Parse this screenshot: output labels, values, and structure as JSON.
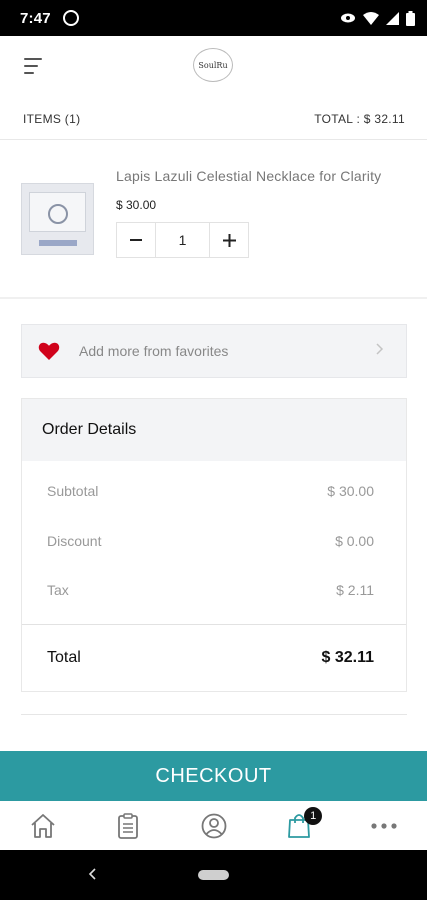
{
  "status_bar": {
    "time": "7:47",
    "icons": [
      "whatsapp-icon",
      "eye-icon",
      "wifi-icon",
      "signal-icon",
      "battery-icon"
    ]
  },
  "app_bar": {
    "logo_text": "SoulRu",
    "icons": [
      "menu-icon"
    ]
  },
  "cart_summary": {
    "items": "ITEMS (1)",
    "total": "TOTAL : $ 32.11"
  },
  "cart_items": [
    {
      "name": "Lapis Lazuli Celestial Necklace for Clarity",
      "price": "$ 30.00",
      "quantity": "1"
    }
  ],
  "favorites": {
    "label": "Add more from favorites",
    "icon": "heart-icon",
    "color": "#d0021b"
  },
  "order_details": {
    "title": "Order Details",
    "subtotal_label": "Subtotal",
    "subtotal_value": "$ 30.00",
    "discount_label": "Discount",
    "discount_value": "$ 0.00",
    "tax_label": "Tax",
    "tax_value": "$ 2.11",
    "total_label": "Total",
    "total_value": "$ 32.11"
  },
  "checkout": {
    "label": "CHECKOUT",
    "color": "#2c9aa1"
  },
  "tab_bar": {
    "tabs": [
      "home-icon",
      "orders-icon",
      "account-icon",
      "cart-icon",
      "more-icon"
    ],
    "active_color": "#2c9aa1",
    "cart_badge": "1"
  }
}
